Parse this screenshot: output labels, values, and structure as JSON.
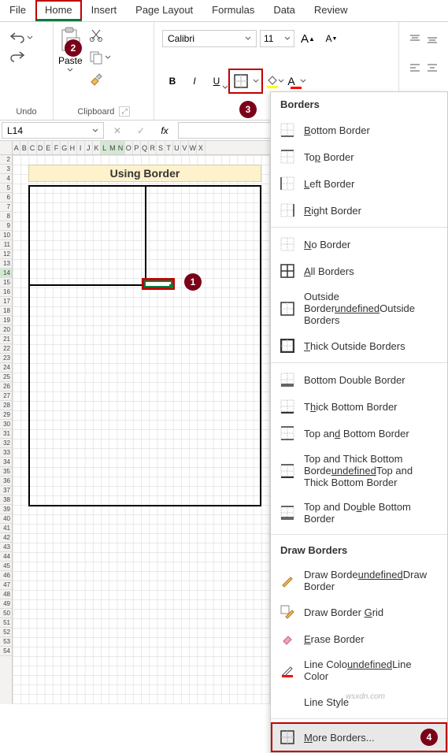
{
  "tabs": {
    "file": "File",
    "home": "Home",
    "insert": "Insert",
    "page_layout": "Page Layout",
    "formulas": "Formulas",
    "data": "Data",
    "review": "Review"
  },
  "groups": {
    "undo": "Undo",
    "clipboard": "Clipboard",
    "paste": "Paste"
  },
  "font": {
    "name": "Calibri",
    "size": "11",
    "bold": "B",
    "italic": "I",
    "underline": "U"
  },
  "grid_size_labels": {
    "increase": "A",
    "decrease": "A"
  },
  "namebox": {
    "value": "L14"
  },
  "fx": {
    "label": "fx",
    "cancel": "✕",
    "confirm": "✓"
  },
  "col_letters": [
    "A",
    "B",
    "C",
    "D",
    "E",
    "F",
    "G",
    "H",
    "I",
    "J",
    "K",
    "L",
    "M",
    "N",
    "O",
    "P",
    "Q",
    "R",
    "S",
    "T",
    "U",
    "V",
    "W",
    "X"
  ],
  "selected_cols": [
    "L",
    "M",
    "N"
  ],
  "row_start": 2,
  "row_end": 54,
  "selected_row": 14,
  "title_cell": "Using Border",
  "callouts": {
    "c1": "1",
    "c2": "2",
    "c3": "3",
    "c4": "4"
  },
  "menu": {
    "header1": "Borders",
    "header2": "Draw Borders",
    "items": [
      {
        "label": "Bottom Border",
        "underline_pos": 0
      },
      {
        "label": "Top Border",
        "underline_char": "p"
      },
      {
        "label": "Left Border",
        "underline_pos": 0
      },
      {
        "label": "Right Border",
        "underline_pos": 0
      },
      {
        "label": "No Border",
        "underline_pos": 0
      },
      {
        "label": "All Borders",
        "underline_pos": 0
      },
      {
        "label": "Outside Borders",
        "underline_char": "S"
      },
      {
        "label": "Thick Outside Borders",
        "underline_pos": 0
      },
      {
        "label": "Bottom Double Border",
        "underline_char2": true
      },
      {
        "label": "Thick Bottom Border",
        "underline_char": "h"
      },
      {
        "label": "Top and Bottom Border",
        "underline_char": "d"
      },
      {
        "label": "Top and Thick Bottom Border",
        "underline_char": "C"
      },
      {
        "label": "Top and Double Bottom Border",
        "underline_char": "u"
      }
    ],
    "draw_items": [
      {
        "label": "Draw Border",
        "underline_char": "W"
      },
      {
        "label": "Draw Border Grid",
        "underline_char": "G"
      },
      {
        "label": "Erase Border",
        "underline_pos": 0
      },
      {
        "label": "Line Color",
        "underline_char": "I"
      },
      {
        "label": "Line Style"
      }
    ],
    "more": "More Borders...",
    "more_underline": "M"
  },
  "watermark": "wsxdn.com"
}
